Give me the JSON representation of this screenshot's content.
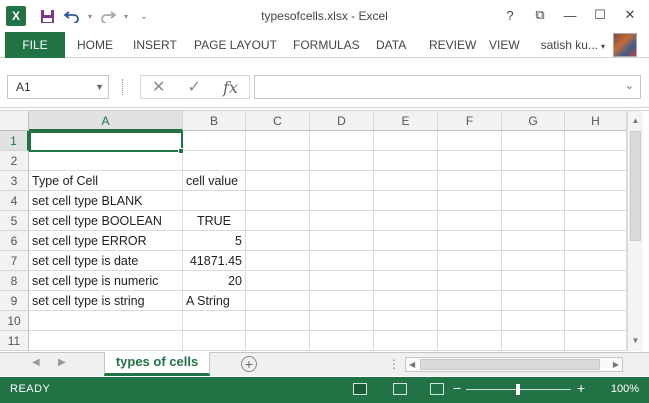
{
  "window": {
    "title": "typesofcells.xlsx - Excel",
    "app_logo": "X",
    "controls": [
      "?",
      "⧉",
      "—",
      "☐",
      "✕"
    ]
  },
  "quick_access": {
    "icons": [
      "save-icon",
      "undo-icon",
      "redo-icon",
      "customize-icon"
    ]
  },
  "ribbon": {
    "tabs": [
      "FILE",
      "HOME",
      "INSERT",
      "PAGE LAYOUT",
      "FORMULAS",
      "DATA",
      "REVIEW",
      "VIEW"
    ],
    "user": "satish ku..."
  },
  "formula_bar": {
    "name_box": "A1",
    "fx": "fx",
    "value": ""
  },
  "grid": {
    "columns": [
      "A",
      "B",
      "C",
      "D",
      "E",
      "F",
      "G",
      "H"
    ],
    "rows": [
      "1",
      "2",
      "3",
      "4",
      "5",
      "6",
      "7",
      "8",
      "9",
      "10",
      "11"
    ],
    "cells": {
      "A3": "Type of Cell",
      "B3": "cell value",
      "A4": "set cell type BLANK",
      "A5": "set cell type BOOLEAN",
      "B5": "TRUE",
      "A6": "set cell type ERROR",
      "B6": "5",
      "A7": "set cell type is date",
      "B7": "41871.45",
      "A8": "set cell type is numeric",
      "B8": "20",
      "A9": "set cell type is string",
      "B9": "A String"
    },
    "active_cell": "A1"
  },
  "sheets": {
    "tabs": [
      "types of cells"
    ],
    "active": "types of cells"
  },
  "status": {
    "mode": "READY",
    "zoom": "100%"
  },
  "colors": {
    "accent": "#217346"
  }
}
